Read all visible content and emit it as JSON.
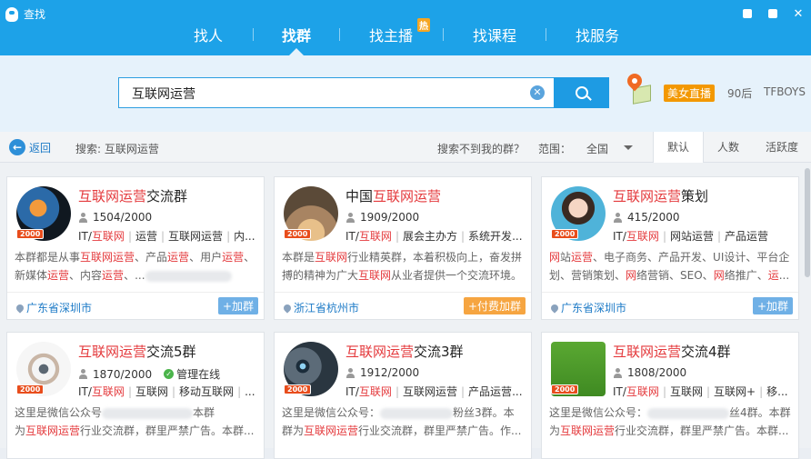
{
  "window": {
    "title": "查找"
  },
  "nav": {
    "tabs": [
      {
        "label": "找人"
      },
      {
        "label": "找群"
      },
      {
        "label": "找主播",
        "badge": "热"
      },
      {
        "label": "找课程"
      },
      {
        "label": "找服务"
      }
    ],
    "active": "找群"
  },
  "search": {
    "query": "互联网运营",
    "hot_tag": "美女直播",
    "hot_links": [
      "90后",
      "TFBOYS"
    ]
  },
  "toolbar": {
    "back_label": "返回",
    "breadcrumb": "搜索: 互联网运营",
    "not_found": "搜索不到我的群？",
    "range_label": "范围：",
    "range_value": "全国",
    "sort_tabs": [
      "默认",
      "人数",
      "活跃度"
    ],
    "active_sort": "默认"
  },
  "groups": [
    {
      "name_hl": "互联网运营",
      "name_pre": "",
      "name_post": "交流群",
      "members": "1504/2000",
      "level": "2000",
      "tags_a": "IT/",
      "tags_hl": "互联网",
      "tags_b": "运营",
      "tags_c": "互联网运营",
      "tags_d": "内...",
      "desc": [
        "本群都是从事",
        "互联网运营",
        "、产品",
        "运营",
        "、用户",
        "运营",
        "、",
        "新媒体",
        "运营",
        "、内容",
        "运营",
        "、..."
      ],
      "location": "广东省深圳市",
      "action": "+加群"
    },
    {
      "name_hl": "互联网运营",
      "name_pre": "中国",
      "name_post": "",
      "members": "1909/2000",
      "level": "2000",
      "tags_a": "IT/",
      "tags_hl": "互联网",
      "tags_b": "展会主办方",
      "tags_c": "系统开发",
      "tags_d": "...",
      "desc": [
        "本群是",
        "互联网",
        "行业精英群，本着积极向上，奋发拼",
        "搏的精神为广大",
        "互联网",
        "从业者提供一个交流环境。"
      ],
      "location": "浙江省杭州市",
      "action": "+付费加群"
    },
    {
      "name_hl": "互联网运营",
      "name_pre": "",
      "name_post": "策划",
      "members": "415/2000",
      "level": "2000",
      "tags_a": "IT/",
      "tags_hl": "互联网",
      "tags_b": "网站运营",
      "tags_c": "产品运营",
      "tags_d": "",
      "desc": [
        "网",
        "站",
        "运营",
        "、电子商务、产品开发、UI设计、平台企",
        "划、营销策划、",
        "网",
        "络营销、SEO、",
        "网",
        "络推广、",
        "运",
        "..."
      ],
      "location": "广东省深圳市",
      "action": "+加群"
    },
    {
      "name_hl": "互联网运营",
      "name_pre": "",
      "name_post": "交流5群",
      "members": "1870/2000",
      "manager": "管理在线",
      "level": "2000",
      "tags_a": "IT/",
      "tags_hl": "互联网",
      "tags_b": "互联网",
      "tags_c": "移动互联网",
      "tags_d": "...",
      "desc": [
        "这里是微信公众号",
        "本群",
        "为",
        "互联网运营",
        "行业交流群，群里严禁广告。本群..."
      ],
      "location": "",
      "action": ""
    },
    {
      "name_hl": "互联网运营",
      "name_pre": "",
      "name_post": "交流3群",
      "members": "1912/2000",
      "level": "2000",
      "tags_a": "IT/",
      "tags_hl": "互联网",
      "tags_b": "互联网运营",
      "tags_c": "产品运营",
      "tags_d": "...",
      "desc": [
        "这里是微信公众号：",
        "粉丝3群。本",
        "群为",
        "互联网运营",
        "行业交流群，群里严禁广告。作..."
      ],
      "location": "",
      "action": ""
    },
    {
      "name_hl": "互联网运营",
      "name_pre": "",
      "name_post": "交流4群",
      "members": "1808/2000",
      "level": "2000",
      "tags_a": "IT/",
      "tags_hl": "互联网",
      "tags_b": "互联网",
      "tags_c": "互联网+",
      "tags_d": "移...",
      "desc": [
        "这里是微信公众号：",
        "丝4群。本群",
        "为",
        "互联网运营",
        "行业交流群，群里严禁广告。本群..."
      ],
      "location": "",
      "action": ""
    }
  ],
  "colors": {
    "brand": "#1da2e8",
    "highlight": "#e4393c",
    "join": "#6fb0e6",
    "paid": "#f6a541",
    "level": "#e84d1c"
  },
  "icons": [
    "penguin-icon",
    "feedback-icon",
    "minimize-icon",
    "close-icon",
    "clear-icon",
    "search-icon",
    "map-pin-icon",
    "back-arrow-icon",
    "person-icon",
    "check-icon",
    "location-pin-icon"
  ]
}
